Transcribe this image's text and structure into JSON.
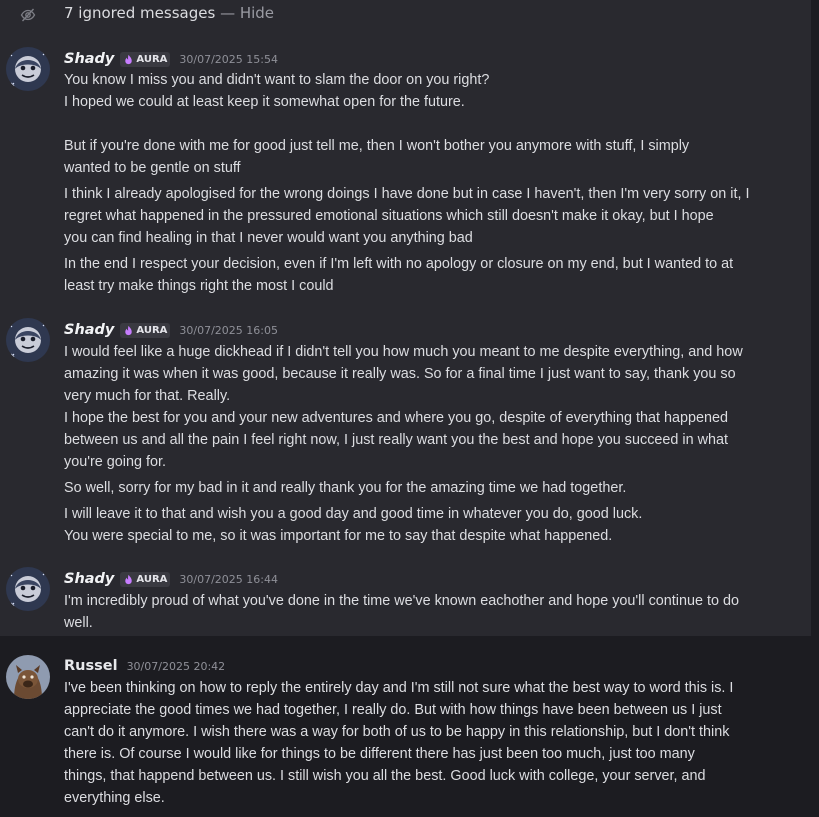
{
  "ignored": {
    "label": "7 ignored messages",
    "dash": "—",
    "hide": "Hide"
  },
  "messages": [
    {
      "user": "Shady",
      "tag": "AURA",
      "time": "30/07/2025 15:54",
      "lines": [
        "You know I miss you and didn't want to slam the door on you right?",
        "I hoped we could at least keep it somewhat open for the future.",
        "But if you're done with me for good just tell me, then I won't bother you anymore with stuff, I simply",
        "wanted to be gentle on stuff",
        "I think I already apologised for the wrong doings I have done but in case I haven't, then I'm very sorry on it, I",
        "regret what happened in the pressured emotional situations which still doesn't make it okay, but I hope",
        "you can find healing in that I never would want you anything bad",
        "In the end I respect your decision, even if I'm left with no apology or closure on my end, but I wanted to at",
        "least try make things right the most I could"
      ]
    },
    {
      "user": "Shady",
      "tag": "AURA",
      "time": "30/07/2025 16:05",
      "lines": [
        "I would feel like a huge dickhead if I didn't tell you how much you meant to me despite everything, and how",
        "amazing it was when it was good, because it really was. So for a final time I just want to say, thank you so",
        "very much for that. Really.",
        "I hope the best for you and your new adventures and where you go, despite of everything that happened",
        "between us and all the pain I feel right now, I just really want you the best and hope you succeed in what",
        "you're going for.",
        "So well, sorry for my bad in it and really thank you for the amazing time we had together.",
        "I will leave it to that and wish you a good day and good time in whatever you do, good luck.",
        "You were special to me, so it was important for me to say that despite what happened."
      ]
    },
    {
      "user": "Shady",
      "tag": "AURA",
      "time": "30/07/2025 16:44",
      "lines": [
        "I'm incredibly proud of what you've done in the time we've known eachother and hope you'll continue to do",
        "well."
      ]
    },
    {
      "user": "Russel",
      "time": "30/07/2025 20:42",
      "lines": [
        "I've been thinking on how to reply the entirely day and I'm still not sure what the best way to word this is. I",
        "appreciate the good times we had together, I really do. But with how things have been between us I just",
        "can't do it anymore. I wish there was a way for both of us to be happy in this relationship, but I don't think",
        "there is. Of course I would like for things to be different there has just been too much, just too many",
        "things, that happend between us. I still wish you all the best. Good luck with college, your server, and",
        "everything else."
      ]
    }
  ]
}
